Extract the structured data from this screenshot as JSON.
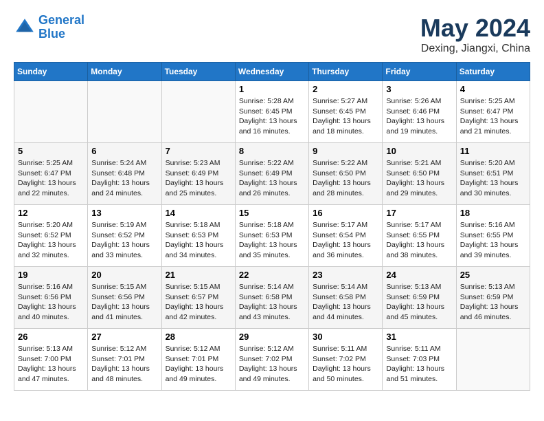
{
  "header": {
    "logo_line1": "General",
    "logo_line2": "Blue",
    "month": "May 2024",
    "location": "Dexing, Jiangxi, China"
  },
  "weekdays": [
    "Sunday",
    "Monday",
    "Tuesday",
    "Wednesday",
    "Thursday",
    "Friday",
    "Saturday"
  ],
  "weeks": [
    [
      {
        "day": "",
        "info": ""
      },
      {
        "day": "",
        "info": ""
      },
      {
        "day": "",
        "info": ""
      },
      {
        "day": "1",
        "info": "Sunrise: 5:28 AM\nSunset: 6:45 PM\nDaylight: 13 hours and 16 minutes."
      },
      {
        "day": "2",
        "info": "Sunrise: 5:27 AM\nSunset: 6:45 PM\nDaylight: 13 hours and 18 minutes."
      },
      {
        "day": "3",
        "info": "Sunrise: 5:26 AM\nSunset: 6:46 PM\nDaylight: 13 hours and 19 minutes."
      },
      {
        "day": "4",
        "info": "Sunrise: 5:25 AM\nSunset: 6:47 PM\nDaylight: 13 hours and 21 minutes."
      }
    ],
    [
      {
        "day": "5",
        "info": "Sunrise: 5:25 AM\nSunset: 6:47 PM\nDaylight: 13 hours and 22 minutes."
      },
      {
        "day": "6",
        "info": "Sunrise: 5:24 AM\nSunset: 6:48 PM\nDaylight: 13 hours and 24 minutes."
      },
      {
        "day": "7",
        "info": "Sunrise: 5:23 AM\nSunset: 6:49 PM\nDaylight: 13 hours and 25 minutes."
      },
      {
        "day": "8",
        "info": "Sunrise: 5:22 AM\nSunset: 6:49 PM\nDaylight: 13 hours and 26 minutes."
      },
      {
        "day": "9",
        "info": "Sunrise: 5:22 AM\nSunset: 6:50 PM\nDaylight: 13 hours and 28 minutes."
      },
      {
        "day": "10",
        "info": "Sunrise: 5:21 AM\nSunset: 6:50 PM\nDaylight: 13 hours and 29 minutes."
      },
      {
        "day": "11",
        "info": "Sunrise: 5:20 AM\nSunset: 6:51 PM\nDaylight: 13 hours and 30 minutes."
      }
    ],
    [
      {
        "day": "12",
        "info": "Sunrise: 5:20 AM\nSunset: 6:52 PM\nDaylight: 13 hours and 32 minutes."
      },
      {
        "day": "13",
        "info": "Sunrise: 5:19 AM\nSunset: 6:52 PM\nDaylight: 13 hours and 33 minutes."
      },
      {
        "day": "14",
        "info": "Sunrise: 5:18 AM\nSunset: 6:53 PM\nDaylight: 13 hours and 34 minutes."
      },
      {
        "day": "15",
        "info": "Sunrise: 5:18 AM\nSunset: 6:53 PM\nDaylight: 13 hours and 35 minutes."
      },
      {
        "day": "16",
        "info": "Sunrise: 5:17 AM\nSunset: 6:54 PM\nDaylight: 13 hours and 36 minutes."
      },
      {
        "day": "17",
        "info": "Sunrise: 5:17 AM\nSunset: 6:55 PM\nDaylight: 13 hours and 38 minutes."
      },
      {
        "day": "18",
        "info": "Sunrise: 5:16 AM\nSunset: 6:55 PM\nDaylight: 13 hours and 39 minutes."
      }
    ],
    [
      {
        "day": "19",
        "info": "Sunrise: 5:16 AM\nSunset: 6:56 PM\nDaylight: 13 hours and 40 minutes."
      },
      {
        "day": "20",
        "info": "Sunrise: 5:15 AM\nSunset: 6:56 PM\nDaylight: 13 hours and 41 minutes."
      },
      {
        "day": "21",
        "info": "Sunrise: 5:15 AM\nSunset: 6:57 PM\nDaylight: 13 hours and 42 minutes."
      },
      {
        "day": "22",
        "info": "Sunrise: 5:14 AM\nSunset: 6:58 PM\nDaylight: 13 hours and 43 minutes."
      },
      {
        "day": "23",
        "info": "Sunrise: 5:14 AM\nSunset: 6:58 PM\nDaylight: 13 hours and 44 minutes."
      },
      {
        "day": "24",
        "info": "Sunrise: 5:13 AM\nSunset: 6:59 PM\nDaylight: 13 hours and 45 minutes."
      },
      {
        "day": "25",
        "info": "Sunrise: 5:13 AM\nSunset: 6:59 PM\nDaylight: 13 hours and 46 minutes."
      }
    ],
    [
      {
        "day": "26",
        "info": "Sunrise: 5:13 AM\nSunset: 7:00 PM\nDaylight: 13 hours and 47 minutes."
      },
      {
        "day": "27",
        "info": "Sunrise: 5:12 AM\nSunset: 7:01 PM\nDaylight: 13 hours and 48 minutes."
      },
      {
        "day": "28",
        "info": "Sunrise: 5:12 AM\nSunset: 7:01 PM\nDaylight: 13 hours and 49 minutes."
      },
      {
        "day": "29",
        "info": "Sunrise: 5:12 AM\nSunset: 7:02 PM\nDaylight: 13 hours and 49 minutes."
      },
      {
        "day": "30",
        "info": "Sunrise: 5:11 AM\nSunset: 7:02 PM\nDaylight: 13 hours and 50 minutes."
      },
      {
        "day": "31",
        "info": "Sunrise: 5:11 AM\nSunset: 7:03 PM\nDaylight: 13 hours and 51 minutes."
      },
      {
        "day": "",
        "info": ""
      }
    ]
  ]
}
